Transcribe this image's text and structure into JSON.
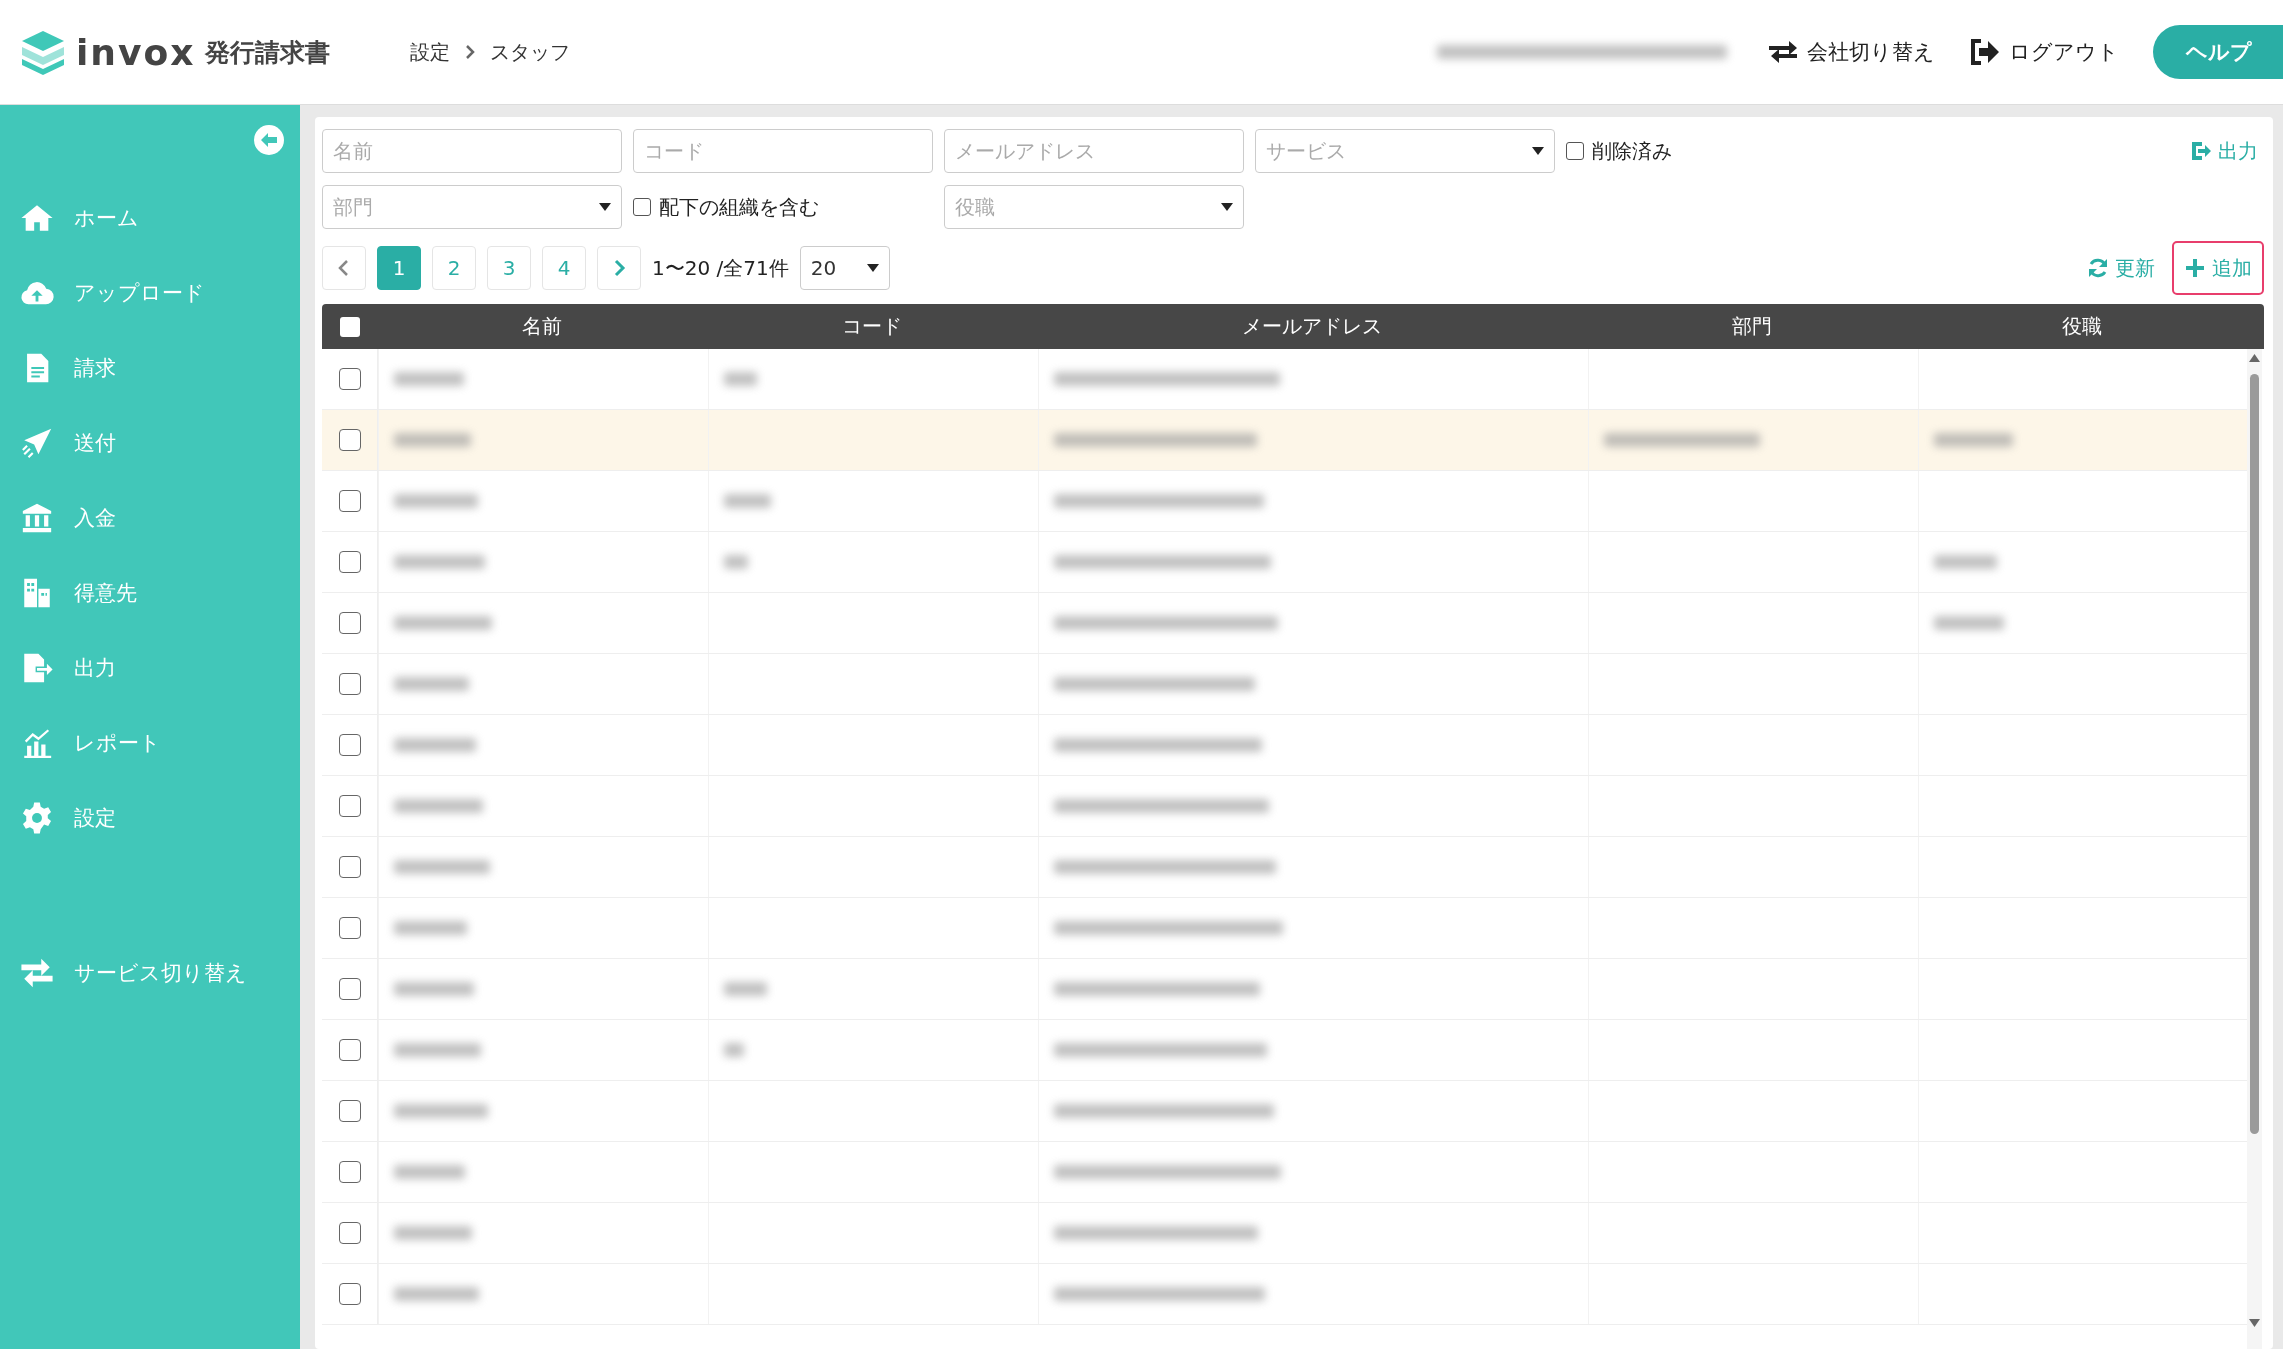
{
  "header": {
    "logo_text": "invox",
    "product": "発行請求書",
    "breadcrumb": [
      "設定",
      "スタッフ"
    ],
    "account": {
      "redacted": true
    },
    "switch_company": "会社切り替え",
    "logout": "ログアウト",
    "help": "ヘルプ"
  },
  "sidebar": {
    "items": [
      {
        "kind": "home",
        "label": "ホーム"
      },
      {
        "kind": "upload",
        "label": "アップロード"
      },
      {
        "kind": "invoice",
        "label": "請求"
      },
      {
        "kind": "send",
        "label": "送付"
      },
      {
        "kind": "bank",
        "label": "入金"
      },
      {
        "kind": "building",
        "label": "得意先"
      },
      {
        "kind": "export",
        "label": "出力"
      },
      {
        "kind": "chart",
        "label": "レポート"
      },
      {
        "kind": "gear",
        "label": "設定"
      }
    ],
    "service_switch": "サービス切り替え"
  },
  "filters": {
    "name": {
      "placeholder": "名前"
    },
    "code": {
      "placeholder": "コード"
    },
    "email": {
      "placeholder": "メールアドレス"
    },
    "service": {
      "placeholder": "サービス"
    },
    "deleted": {
      "label": "削除済み",
      "checked": false
    },
    "export": "出力",
    "department": {
      "placeholder": "部門"
    },
    "include_sub": {
      "label": "配下の組織を含む",
      "checked": false
    },
    "role": {
      "placeholder": "役職"
    }
  },
  "pagination": {
    "pages": [
      {
        "label": "1",
        "selected": true
      },
      {
        "label": "2",
        "selected": false
      },
      {
        "label": "3",
        "selected": false
      },
      {
        "label": "4",
        "selected": false
      }
    ],
    "summary": "1〜20 /全71件",
    "page_size": "20",
    "refresh": "更新",
    "add": "追加"
  },
  "table": {
    "header_checked": false,
    "columns": [
      "名前",
      "コード",
      "メールアドレス",
      "部門",
      "役職"
    ],
    "rows": [
      {
        "selected": false,
        "checked": false,
        "filled": [
          true,
          true,
          true,
          false,
          false
        ]
      },
      {
        "selected": true,
        "checked": false,
        "filled": [
          true,
          false,
          true,
          true,
          true
        ]
      },
      {
        "selected": false,
        "checked": false,
        "filled": [
          true,
          true,
          true,
          false,
          false
        ]
      },
      {
        "selected": false,
        "checked": false,
        "filled": [
          true,
          true,
          true,
          false,
          true
        ]
      },
      {
        "selected": false,
        "checked": false,
        "filled": [
          true,
          false,
          true,
          false,
          true
        ]
      },
      {
        "selected": false,
        "checked": false,
        "filled": [
          true,
          false,
          true,
          false,
          false
        ]
      },
      {
        "selected": false,
        "checked": false,
        "filled": [
          true,
          false,
          true,
          false,
          false
        ]
      },
      {
        "selected": false,
        "checked": false,
        "filled": [
          true,
          false,
          true,
          false,
          false
        ]
      },
      {
        "selected": false,
        "checked": false,
        "filled": [
          true,
          false,
          true,
          false,
          false
        ]
      },
      {
        "selected": false,
        "checked": false,
        "filled": [
          true,
          false,
          true,
          false,
          false
        ]
      },
      {
        "selected": false,
        "checked": false,
        "filled": [
          true,
          true,
          true,
          false,
          false
        ]
      },
      {
        "selected": false,
        "checked": false,
        "filled": [
          true,
          true,
          true,
          false,
          false
        ]
      },
      {
        "selected": false,
        "checked": false,
        "filled": [
          true,
          false,
          true,
          false,
          false
        ]
      },
      {
        "selected": false,
        "checked": false,
        "filled": [
          true,
          false,
          true,
          false,
          false
        ]
      },
      {
        "selected": false,
        "checked": false,
        "filled": [
          true,
          false,
          true,
          false,
          false
        ]
      },
      {
        "selected": false,
        "checked": false,
        "filled": [
          true,
          false,
          true,
          false,
          false
        ]
      }
    ]
  }
}
